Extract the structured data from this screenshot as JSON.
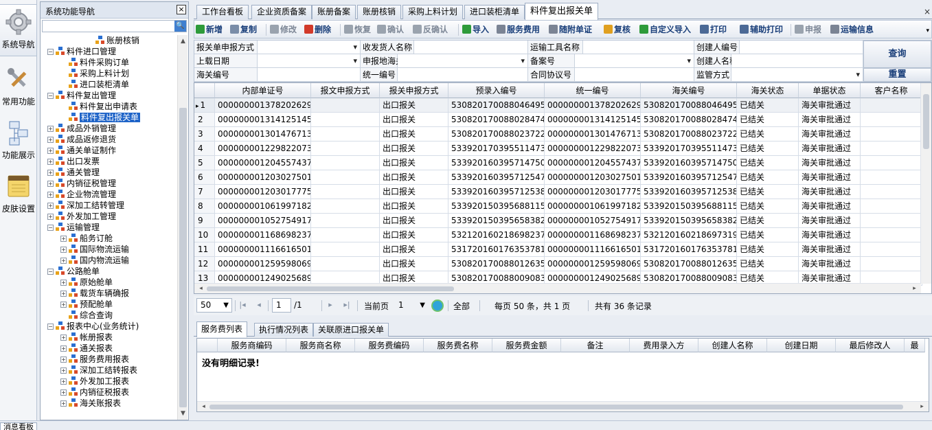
{
  "iconbar": {
    "items": [
      {
        "label": "系统导航",
        "icon": "gear-icon"
      },
      {
        "label": "常用功能",
        "icon": "tools-icon"
      },
      {
        "label": "功能展示",
        "icon": "diagram-icon"
      },
      {
        "label": "皮肤设置",
        "icon": "notebook-icon"
      }
    ]
  },
  "nav": {
    "title": "系统功能导航",
    "close": "×",
    "search_icon": "🔍",
    "tree": [
      {
        "label": "账册核销",
        "expander": "",
        "level": 2
      },
      {
        "label": "料件进口管理",
        "expander": "−",
        "level": 0
      },
      {
        "label": "料件采购订单",
        "expander": "",
        "level": 1
      },
      {
        "label": "采购上料计划",
        "expander": "",
        "level": 1
      },
      {
        "label": "进口装柜清单",
        "expander": "",
        "level": 1
      },
      {
        "label": "料件复出管理",
        "expander": "−",
        "level": 0
      },
      {
        "label": "料件复出申请表",
        "expander": "",
        "level": 1
      },
      {
        "label": "料件复出报关单",
        "expander": "",
        "level": 1,
        "selected": true
      },
      {
        "label": "成品外销管理",
        "expander": "+",
        "level": 0
      },
      {
        "label": "成品返修退货",
        "expander": "+",
        "level": 0
      },
      {
        "label": "通关单证制作",
        "expander": "+",
        "level": 0
      },
      {
        "label": "出口发票",
        "expander": "+",
        "level": 0
      },
      {
        "label": "通关管理",
        "expander": "+",
        "level": 0
      },
      {
        "label": "内销征税管理",
        "expander": "+",
        "level": 0
      },
      {
        "label": "企业物流管理",
        "expander": "+",
        "level": 0
      },
      {
        "label": "深加工结转管理",
        "expander": "+",
        "level": 0
      },
      {
        "label": "外发加工管理",
        "expander": "+",
        "level": 0
      },
      {
        "label": "运输管理",
        "expander": "−",
        "level": 0
      },
      {
        "label": "船务订舱",
        "expander": "+",
        "level": 1
      },
      {
        "label": "国际物流运输",
        "expander": "+",
        "level": 1
      },
      {
        "label": "国内物流运输",
        "expander": "+",
        "level": 1
      },
      {
        "label": "公路舱单",
        "expander": "−",
        "level": 0
      },
      {
        "label": "原始舱单",
        "expander": "+",
        "level": 1
      },
      {
        "label": "载货车辆确报",
        "expander": "+",
        "level": 1
      },
      {
        "label": "预配舱单",
        "expander": "+",
        "level": 1
      },
      {
        "label": "综合查询",
        "expander": "",
        "level": 1
      },
      {
        "label": "报表中心(业务统计)",
        "expander": "−",
        "level": 0
      },
      {
        "label": "帐册报表",
        "expander": "+",
        "level": 1
      },
      {
        "label": "通关报表",
        "expander": "+",
        "level": 1
      },
      {
        "label": "服务费用报表",
        "expander": "+",
        "level": 1
      },
      {
        "label": "深加工结转报表",
        "expander": "+",
        "level": 1
      },
      {
        "label": "外发加工报表",
        "expander": "+",
        "level": 1
      },
      {
        "label": "内销征税报表",
        "expander": "+",
        "level": 1
      },
      {
        "label": "海关账报表",
        "expander": "+",
        "level": 1
      }
    ]
  },
  "tabs": [
    "工作台看板",
    "企业资质备案",
    "账册备案",
    "账册核销",
    "采购上料计划",
    "进口装柜清单",
    "料件复出报关单"
  ],
  "tab_close": "×",
  "toolbar": [
    {
      "label": "新增",
      "icon": "add-icon",
      "color": "#2e9b3a",
      "enabled": true
    },
    {
      "label": "复制",
      "icon": "copy-icon",
      "color": "#7a8da8",
      "enabled": true
    },
    {
      "label": "修改",
      "icon": "edit-icon",
      "color": "#9aa3ae",
      "enabled": false
    },
    {
      "label": "删除",
      "icon": "delete-icon",
      "color": "#d23a2a",
      "enabled": true
    },
    {
      "label": "恢复",
      "icon": "undo-icon",
      "color": "#9aa3ae",
      "enabled": false
    },
    {
      "label": "确认",
      "icon": "check-icon",
      "color": "#9aa3ae",
      "enabled": false
    },
    {
      "label": "反确认",
      "icon": "uncheck-icon",
      "color": "#9aa3ae",
      "enabled": false
    },
    {
      "label": "导入",
      "icon": "import-icon",
      "color": "#2e9b3a",
      "enabled": true
    },
    {
      "label": "服务费用",
      "icon": "gear-icon",
      "color": "#7b8494",
      "enabled": true
    },
    {
      "label": "随附单证",
      "icon": "gear-icon",
      "color": "#7b8494",
      "enabled": true
    },
    {
      "label": "复核",
      "icon": "lock-icon",
      "color": "#e0a020",
      "enabled": true
    },
    {
      "label": "自定义导入",
      "icon": "import-icon",
      "color": "#2e9b3a",
      "enabled": true
    },
    {
      "label": "打印",
      "icon": "print-icon",
      "color": "#4c6a96",
      "enabled": true
    },
    {
      "label": "辅助打印",
      "icon": "print-icon",
      "color": "#4c6a96",
      "enabled": true
    },
    {
      "label": "申报",
      "icon": "declare-icon",
      "color": "#9aa3ae",
      "enabled": false
    },
    {
      "label": "运输信息",
      "icon": "gear-icon",
      "color": "#7b8494",
      "enabled": true
    }
  ],
  "filters": {
    "row1": [
      {
        "label": "报关单申报方式",
        "value": "",
        "dropdown": true
      },
      {
        "label": "收发货人名称",
        "value": "",
        "dropdown": false
      },
      {
        "label": "运输工具名称",
        "value": "",
        "dropdown": false
      },
      {
        "label": "创建人编号",
        "value": "",
        "dropdown": false
      }
    ],
    "row2": [
      {
        "label": "上载日期",
        "value": "",
        "dropdown": true
      },
      {
        "label": "申报地海关",
        "value": "",
        "dropdown": true
      },
      {
        "label": "备案号",
        "value": "",
        "dropdown": true
      },
      {
        "label": "创建人名称",
        "value": "",
        "dropdown": false
      }
    ],
    "row3": [
      {
        "label": "海关编号",
        "value": "",
        "dropdown": false
      },
      {
        "label": "统一编号",
        "value": "",
        "dropdown": false
      },
      {
        "label": "合同协议号",
        "value": "",
        "dropdown": false
      },
      {
        "label": "监管方式",
        "value": "",
        "dropdown": true
      }
    ],
    "query_button": "查询",
    "reset_button": "重置"
  },
  "grid": {
    "columns": [
      "内部单证号",
      "报文申报方式",
      "报关申报方式",
      "预录入编号",
      "统一编号",
      "海关编号",
      "海关状态",
      "单据状态",
      "客户名称"
    ],
    "rows": [
      {
        "n": "1",
        "cells": [
          "000000001378202629",
          "",
          "出口报关",
          "530820170088046495",
          "000000001378202629",
          "530820170088046495",
          "已结关",
          "海关审批通过",
          ""
        ]
      },
      {
        "n": "2",
        "cells": [
          "000000001314125145",
          "",
          "出口报关",
          "530820170088028474",
          "000000001314125145",
          "530820170088028474",
          "已结关",
          "海关审批通过",
          ""
        ]
      },
      {
        "n": "3",
        "cells": [
          "000000001301476713",
          "",
          "出口报关",
          "530820170088023722",
          "000000001301476713",
          "530820170088023722",
          "已结关",
          "海关审批通过",
          ""
        ]
      },
      {
        "n": "4",
        "cells": [
          "000000001229822073",
          "",
          "出口报关",
          "533920170395511473",
          "000000001229822073",
          "533920170395511473",
          "已结关",
          "海关审批通过",
          ""
        ]
      },
      {
        "n": "5",
        "cells": [
          "000000001204557437",
          "",
          "出口报关",
          "533920160395714750",
          "000000001204557437",
          "533920160395714750",
          "已结关",
          "海关审批通过",
          ""
        ]
      },
      {
        "n": "6",
        "cells": [
          "000000001203027501",
          "",
          "出口报关",
          "533920160395712547",
          "000000001203027501",
          "533920160395712547",
          "已结关",
          "海关审批通过",
          ""
        ]
      },
      {
        "n": "7",
        "cells": [
          "000000001203017775",
          "",
          "出口报关",
          "533920160395712538",
          "000000001203017775",
          "533920160395712538",
          "已结关",
          "海关审批通过",
          ""
        ]
      },
      {
        "n": "8",
        "cells": [
          "000000001061997182",
          "",
          "出口报关",
          "533920150395688115",
          "000000001061997182",
          "533920150395688115",
          "已结关",
          "海关审批通过",
          ""
        ]
      },
      {
        "n": "9",
        "cells": [
          "000000001052754917",
          "",
          "出口报关",
          "533920150395658382",
          "000000001052754917",
          "533920150395658382",
          "已结关",
          "海关审批通过",
          ""
        ]
      },
      {
        "n": "10",
        "cells": [
          "000000001168698237",
          "",
          "出口报关",
          "532120160218698237",
          "000000001168698237",
          "532120160218697319",
          "已结关",
          "海关审批通过",
          ""
        ]
      },
      {
        "n": "11",
        "cells": [
          "000000001116616501",
          "",
          "出口报关",
          "531720160176353781",
          "000000001116616501",
          "531720160176353781",
          "已结关",
          "海关审批通过",
          ""
        ]
      },
      {
        "n": "12",
        "cells": [
          "000000001259598069",
          "",
          "出口报关",
          "530820170088012635",
          "000000001259598069",
          "530820170088012635",
          "已结关",
          "海关审批通过",
          ""
        ]
      },
      {
        "n": "13",
        "cells": [
          "000000001249025689",
          "",
          "出口报关",
          "530820170088009083",
          "000000001249025689",
          "530820170088009083",
          "已结关",
          "海关审批通过",
          ""
        ]
      }
    ],
    "current_marker": "▸"
  },
  "pager": {
    "page_size": "50",
    "page_input": "1",
    "page_total": "/1",
    "current_page_label": "当前页",
    "current_page_value": "1",
    "all_label": "全部",
    "summary": "每页 50 条，共 1 页",
    "total": "共有 36 条记录"
  },
  "detail": {
    "tabs": [
      "服务费列表",
      "执行情况列表",
      "关联原进口报关单"
    ],
    "columns": [
      "服务商编码",
      "服务商名称",
      "服务费编码",
      "服务费名称",
      "服务费金额",
      "备注",
      "费用录入方",
      "创建人名称",
      "创建日期",
      "最后修改人",
      "最"
    ],
    "empty": "没有明细记录!"
  },
  "statusbar": {
    "tab": "消息看板"
  }
}
